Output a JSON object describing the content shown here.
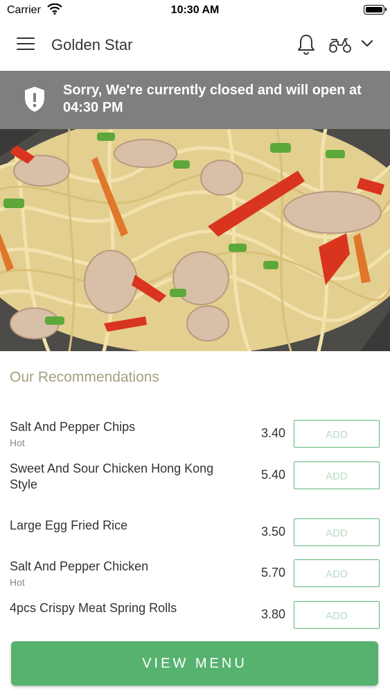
{
  "status_bar": {
    "carrier": "Carrier",
    "time": "10:30 AM"
  },
  "header": {
    "title": "Golden Star"
  },
  "banner": {
    "message": "Sorry, We're currently closed and will open at 04:30 PM",
    "background": "#7f7f7f"
  },
  "recommendations": {
    "title": "Our Recommendations",
    "items": [
      {
        "name": "Salt And Pepper Chips",
        "sub": "Hot",
        "price": "3.40",
        "button": "ADD"
      },
      {
        "name": "Sweet And Sour Chicken Hong Kong Style",
        "sub": "",
        "price": "5.40",
        "button": "ADD"
      },
      {
        "name": "Large Egg Fried Rice",
        "sub": "",
        "price": "3.50",
        "button": "ADD"
      },
      {
        "name": "Salt And Pepper Chicken",
        "sub": "Hot",
        "price": "5.70",
        "button": "ADD"
      },
      {
        "name": "4pcs Crispy Meat Spring Rolls",
        "sub": "",
        "price": "3.80",
        "button": "ADD"
      }
    ]
  },
  "footer": {
    "view_menu": "VIEW MENU",
    "accent": "#58b26f"
  }
}
